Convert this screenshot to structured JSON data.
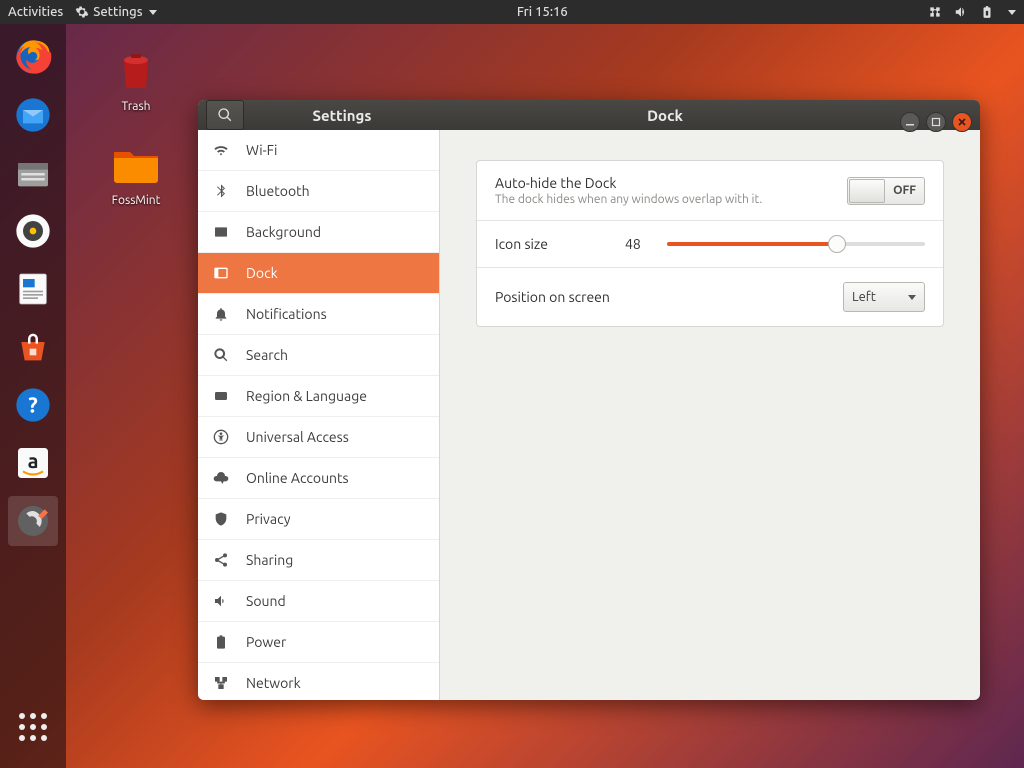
{
  "topbar": {
    "activities": "Activities",
    "appmenu": "Settings",
    "clock": "Fri 15:16"
  },
  "desktop": {
    "trash": "Trash",
    "folder": "FossMint"
  },
  "window": {
    "sidetitle": "Settings",
    "maintitle": "Dock"
  },
  "sidebar": {
    "items": [
      {
        "label": "Wi-Fi"
      },
      {
        "label": "Bluetooth"
      },
      {
        "label": "Background"
      },
      {
        "label": "Dock"
      },
      {
        "label": "Notifications"
      },
      {
        "label": "Search"
      },
      {
        "label": "Region & Language"
      },
      {
        "label": "Universal Access"
      },
      {
        "label": "Online Accounts"
      },
      {
        "label": "Privacy"
      },
      {
        "label": "Sharing"
      },
      {
        "label": "Sound"
      },
      {
        "label": "Power"
      },
      {
        "label": "Network"
      }
    ]
  },
  "dock": {
    "autohide_label": "Auto-hide the Dock",
    "autohide_sub": "The dock hides when any windows overlap with it.",
    "autohide_state": "OFF",
    "iconsize_label": "Icon size",
    "iconsize_value": "48",
    "position_label": "Position on screen",
    "position_value": "Left"
  }
}
